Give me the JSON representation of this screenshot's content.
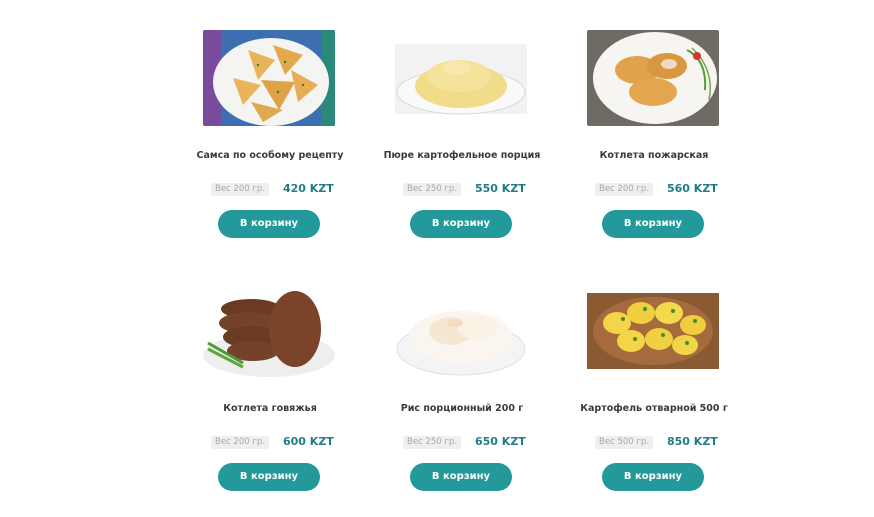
{
  "products": [
    {
      "title": "Самса по особому рецепту",
      "weight": "Вес 200 гр.",
      "price": "420 KZT",
      "button": "В корзину",
      "image_icon": "samsa-image"
    },
    {
      "title": "Пюре картофельное порция",
      "weight": "Вес 250 гр.",
      "price": "550 KZT",
      "button": "В корзину",
      "image_icon": "mashed-potatoes-image"
    },
    {
      "title": "Котлета пожарская",
      "weight": "Вес 200 гр.",
      "price": "560 KZT",
      "button": "В корзину",
      "image_icon": "pozharsky-cutlet-image"
    },
    {
      "title": "Котлета говяжья",
      "weight": "Вес 200 гр.",
      "price": "600 KZT",
      "button": "В корзину",
      "image_icon": "beef-cutlet-image"
    },
    {
      "title": "Рис порционный 200 г",
      "weight": "Вес 250 гр.",
      "price": "650 KZT",
      "button": "В корзину",
      "image_icon": "rice-image"
    },
    {
      "title": "Картофель отварной 500 г",
      "weight": "Вес 500 гр.",
      "price": "850 KZT",
      "button": "В корзину",
      "image_icon": "boiled-potatoes-image"
    }
  ],
  "colors": {
    "accent_button": "#23999b",
    "price_text": "#1f7d88",
    "title_text": "#3a3a3a",
    "weight_text": "#a8a8a8",
    "weight_bg": "#efefef"
  }
}
